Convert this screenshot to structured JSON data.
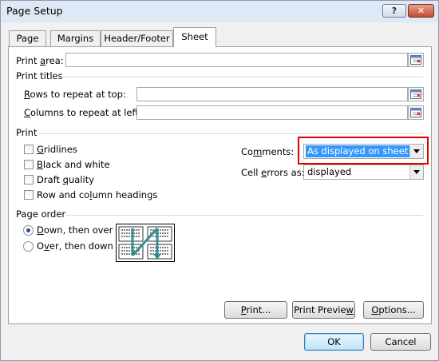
{
  "window": {
    "title": "Page Setup",
    "help_label": "?",
    "close_label": "✕"
  },
  "tabs": [
    {
      "label": "Page",
      "active": false
    },
    {
      "label": "Margins",
      "active": false
    },
    {
      "label": "Header/Footer",
      "active": false
    },
    {
      "label": "Sheet",
      "active": true
    }
  ],
  "print_area": {
    "label_pre": "Print ",
    "label_key": "a",
    "label_post": "rea:",
    "value": ""
  },
  "print_titles": {
    "heading": "Print titles",
    "rows": {
      "label_key": "R",
      "label_post": "ows to repeat at top:",
      "value": ""
    },
    "columns": {
      "label_key": "C",
      "label_post": "olumns to repeat at left:",
      "value": ""
    }
  },
  "print": {
    "heading": "Print",
    "gridlines": {
      "label_key": "G",
      "label_post": "ridlines",
      "checked": false
    },
    "black_white": {
      "label_key": "B",
      "label_post": "lack and white",
      "checked": false
    },
    "draft_quality": {
      "label_pre": "Draft ",
      "label_key": "q",
      "label_post": "uality",
      "checked": false
    },
    "row_col_headings": {
      "label_pre": "Row and co",
      "label_key": "l",
      "label_post": "umn headings",
      "checked": false
    },
    "comments": {
      "label_pre": "Co",
      "label_key": "m",
      "label_post": "ments:",
      "value": "As displayed on sheet"
    },
    "cell_errors": {
      "label_pre": "Cell ",
      "label_key": "e",
      "label_post": "rrors as:",
      "value": "displayed"
    }
  },
  "page_order": {
    "heading": "Page order",
    "down_then_over": {
      "label_key": "D",
      "label_post": "own, then over",
      "selected": true
    },
    "over_then_down": {
      "label_pre": "O",
      "label_key": "v",
      "label_post": "er, then down",
      "selected": false
    }
  },
  "buttons": {
    "print": {
      "label_key": "P",
      "label_post": "rint..."
    },
    "print_preview": {
      "label_pre": "Print Previe",
      "label_key": "w",
      "label_post": ""
    },
    "options": {
      "label_key": "O",
      "label_post": "ptions..."
    },
    "ok": "OK",
    "cancel": "Cancel"
  },
  "colors": {
    "highlight": "#e00000",
    "selection": "#3399ff",
    "order_arrow": "#2f8f8f"
  },
  "icons": [
    "collapse-dialog-icon",
    "page-order-diagram-icon",
    "dropdown-arrow-icon"
  ]
}
